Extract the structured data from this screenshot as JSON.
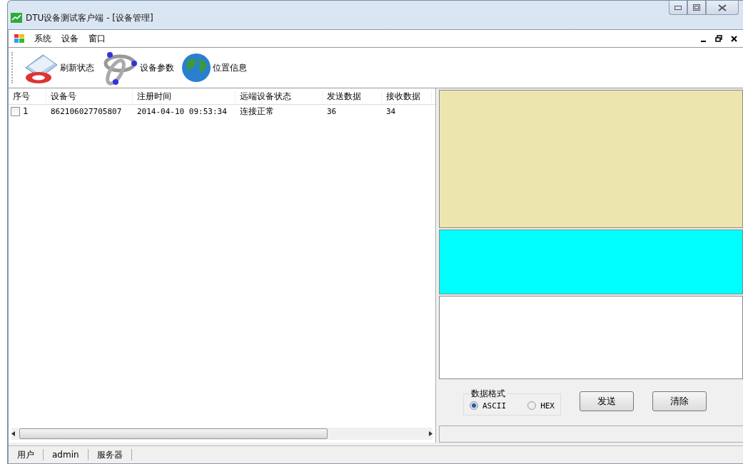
{
  "window": {
    "title": "DTU设备测试客户端 - [设备管理]"
  },
  "menu": [
    "系统",
    "设备",
    "窗口"
  ],
  "toolbar": [
    {
      "kind": "refresh",
      "label": "刷新状态"
    },
    {
      "kind": "params",
      "label": "设备参数"
    },
    {
      "kind": "globe",
      "label": "位置信息"
    }
  ],
  "table": {
    "columns": [
      "序号",
      "设备号",
      "注册时间",
      "远端设备状态",
      "发送数据",
      "接收数据"
    ],
    "rows": [
      {
        "checked": false,
        "cells": [
          "1",
          "862106027705807",
          "2014-04-10 09:53:34",
          "连接正常",
          "36",
          "34"
        ]
      }
    ]
  },
  "data_format": {
    "title": "数据格式",
    "options": [
      {
        "label": "ASCII",
        "selected": true
      },
      {
        "label": "HEX",
        "selected": false
      }
    ]
  },
  "buttons": [
    "发送",
    "清除"
  ],
  "status_bar": [
    "用户",
    "admin",
    "服务器"
  ]
}
